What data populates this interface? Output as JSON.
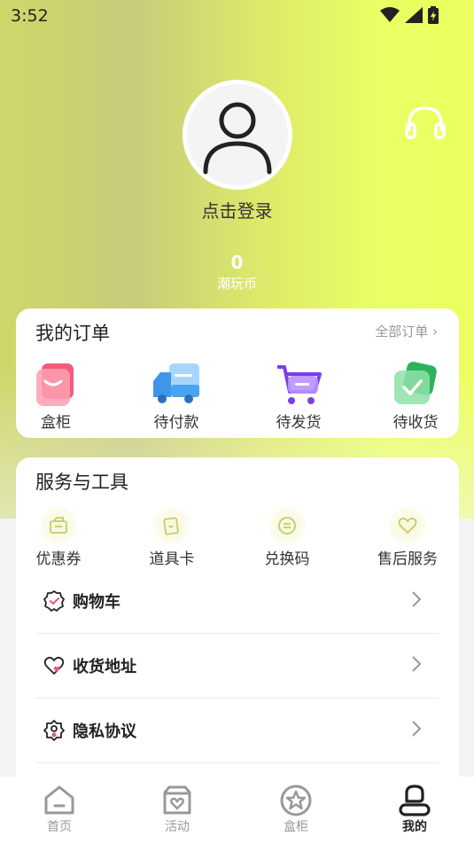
{
  "status_bar": {
    "time": "3:52"
  },
  "profile": {
    "login_text": "点击登录",
    "coins_value": "0",
    "coins_label": "潮玩币"
  },
  "orders": {
    "title": "我的订单",
    "all_link": "全部订单 ›",
    "items": [
      {
        "label": "盒柜",
        "icon": "box-cabinet-icon"
      },
      {
        "label": "待付款",
        "icon": "truck-icon"
      },
      {
        "label": "待发货",
        "icon": "cart-icon"
      },
      {
        "label": "待收货",
        "icon": "check-box-icon"
      }
    ]
  },
  "services": {
    "title": "服务与工具",
    "items": [
      {
        "label": "优惠券",
        "icon": "coupon-icon"
      },
      {
        "label": "道具卡",
        "icon": "prop-card-icon"
      },
      {
        "label": "兑换码",
        "icon": "redeem-code-icon"
      },
      {
        "label": "售后服务",
        "icon": "after-sales-icon"
      }
    ],
    "menu": [
      {
        "label": "购物车",
        "icon": "shopping-cart-badge-icon"
      },
      {
        "label": "收货地址",
        "icon": "address-heart-icon"
      },
      {
        "label": "隐私协议",
        "icon": "privacy-icon"
      }
    ]
  },
  "tabbar": {
    "tabs": [
      {
        "label": "首页",
        "icon": "home-icon"
      },
      {
        "label": "活动",
        "icon": "activity-icon"
      },
      {
        "label": "盒柜",
        "icon": "star-icon"
      },
      {
        "label": "我的",
        "icon": "profile-icon"
      }
    ],
    "active_index": 3
  },
  "colors": {
    "accent": "#e9ff60",
    "pink": "#e8508a",
    "blue": "#4aa3f0",
    "purple": "#8a4cf0",
    "green": "#3cc16a"
  }
}
